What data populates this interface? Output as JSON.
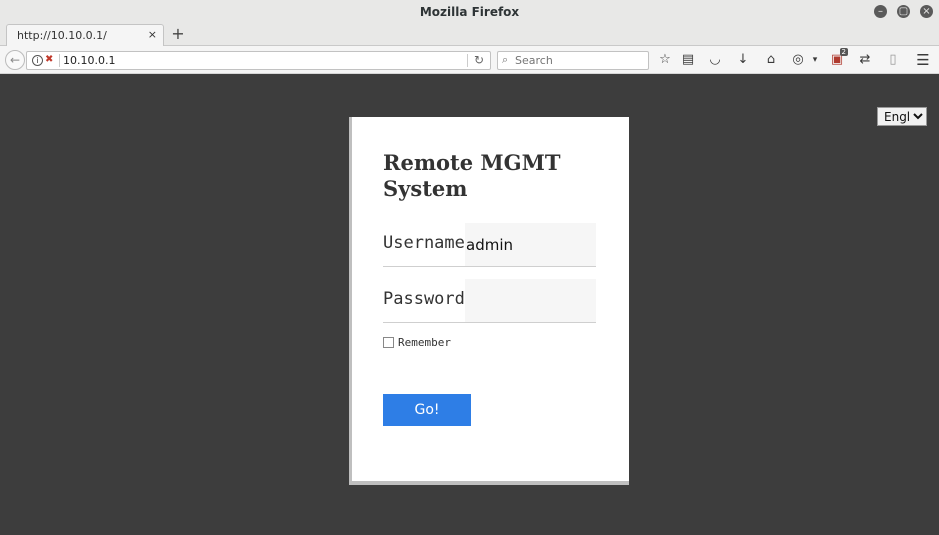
{
  "window": {
    "title": "Mozilla Firefox",
    "controls": {
      "minimize": "–",
      "maximize": "▢",
      "close": "×"
    }
  },
  "tabs": [
    {
      "title": "http://10.10.0.1/",
      "close": "×",
      "active": true
    }
  ],
  "new_tab_label": "+",
  "navbar": {
    "back_glyph": "←",
    "url": "10.10.0.1",
    "reload_glyph": "↻",
    "search_placeholder": "Search",
    "toolbar_icons": [
      "bookmark-star-icon",
      "reading-list-icon",
      "pocket-icon",
      "download-icon",
      "home-icon",
      "customize-icon",
      "extension-icon",
      "sync-icon",
      "sidebar-icon",
      "menu-icon"
    ],
    "extension_badge": "2"
  },
  "language": {
    "selected": "English"
  },
  "login": {
    "heading": "Remote MGMT System",
    "username_label": "Username",
    "username_value": "admin",
    "password_label": "Password",
    "password_value": "",
    "remember_label": "Remember",
    "remember_checked": false,
    "submit_label": "Go!"
  },
  "colors": {
    "page_background": "#3d3d3d",
    "button": "#2e7ee6",
    "card": "#ffffff"
  }
}
